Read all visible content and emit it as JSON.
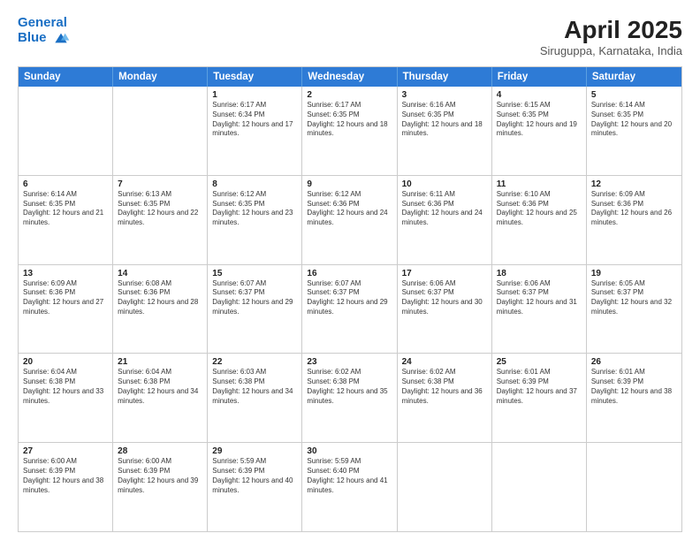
{
  "header": {
    "logo_line1": "General",
    "logo_line2": "Blue",
    "month_year": "April 2025",
    "location": "Siruguppa, Karnataka, India"
  },
  "weekdays": [
    "Sunday",
    "Monday",
    "Tuesday",
    "Wednesday",
    "Thursday",
    "Friday",
    "Saturday"
  ],
  "weeks": [
    [
      {
        "day": "",
        "sunrise": "",
        "sunset": "",
        "daylight": ""
      },
      {
        "day": "",
        "sunrise": "",
        "sunset": "",
        "daylight": ""
      },
      {
        "day": "1",
        "sunrise": "Sunrise: 6:17 AM",
        "sunset": "Sunset: 6:34 PM",
        "daylight": "Daylight: 12 hours and 17 minutes."
      },
      {
        "day": "2",
        "sunrise": "Sunrise: 6:17 AM",
        "sunset": "Sunset: 6:35 PM",
        "daylight": "Daylight: 12 hours and 18 minutes."
      },
      {
        "day": "3",
        "sunrise": "Sunrise: 6:16 AM",
        "sunset": "Sunset: 6:35 PM",
        "daylight": "Daylight: 12 hours and 18 minutes."
      },
      {
        "day": "4",
        "sunrise": "Sunrise: 6:15 AM",
        "sunset": "Sunset: 6:35 PM",
        "daylight": "Daylight: 12 hours and 19 minutes."
      },
      {
        "day": "5",
        "sunrise": "Sunrise: 6:14 AM",
        "sunset": "Sunset: 6:35 PM",
        "daylight": "Daylight: 12 hours and 20 minutes."
      }
    ],
    [
      {
        "day": "6",
        "sunrise": "Sunrise: 6:14 AM",
        "sunset": "Sunset: 6:35 PM",
        "daylight": "Daylight: 12 hours and 21 minutes."
      },
      {
        "day": "7",
        "sunrise": "Sunrise: 6:13 AM",
        "sunset": "Sunset: 6:35 PM",
        "daylight": "Daylight: 12 hours and 22 minutes."
      },
      {
        "day": "8",
        "sunrise": "Sunrise: 6:12 AM",
        "sunset": "Sunset: 6:35 PM",
        "daylight": "Daylight: 12 hours and 23 minutes."
      },
      {
        "day": "9",
        "sunrise": "Sunrise: 6:12 AM",
        "sunset": "Sunset: 6:36 PM",
        "daylight": "Daylight: 12 hours and 24 minutes."
      },
      {
        "day": "10",
        "sunrise": "Sunrise: 6:11 AM",
        "sunset": "Sunset: 6:36 PM",
        "daylight": "Daylight: 12 hours and 24 minutes."
      },
      {
        "day": "11",
        "sunrise": "Sunrise: 6:10 AM",
        "sunset": "Sunset: 6:36 PM",
        "daylight": "Daylight: 12 hours and 25 minutes."
      },
      {
        "day": "12",
        "sunrise": "Sunrise: 6:09 AM",
        "sunset": "Sunset: 6:36 PM",
        "daylight": "Daylight: 12 hours and 26 minutes."
      }
    ],
    [
      {
        "day": "13",
        "sunrise": "Sunrise: 6:09 AM",
        "sunset": "Sunset: 6:36 PM",
        "daylight": "Daylight: 12 hours and 27 minutes."
      },
      {
        "day": "14",
        "sunrise": "Sunrise: 6:08 AM",
        "sunset": "Sunset: 6:36 PM",
        "daylight": "Daylight: 12 hours and 28 minutes."
      },
      {
        "day": "15",
        "sunrise": "Sunrise: 6:07 AM",
        "sunset": "Sunset: 6:37 PM",
        "daylight": "Daylight: 12 hours and 29 minutes."
      },
      {
        "day": "16",
        "sunrise": "Sunrise: 6:07 AM",
        "sunset": "Sunset: 6:37 PM",
        "daylight": "Daylight: 12 hours and 29 minutes."
      },
      {
        "day": "17",
        "sunrise": "Sunrise: 6:06 AM",
        "sunset": "Sunset: 6:37 PM",
        "daylight": "Daylight: 12 hours and 30 minutes."
      },
      {
        "day": "18",
        "sunrise": "Sunrise: 6:06 AM",
        "sunset": "Sunset: 6:37 PM",
        "daylight": "Daylight: 12 hours and 31 minutes."
      },
      {
        "day": "19",
        "sunrise": "Sunrise: 6:05 AM",
        "sunset": "Sunset: 6:37 PM",
        "daylight": "Daylight: 12 hours and 32 minutes."
      }
    ],
    [
      {
        "day": "20",
        "sunrise": "Sunrise: 6:04 AM",
        "sunset": "Sunset: 6:38 PM",
        "daylight": "Daylight: 12 hours and 33 minutes."
      },
      {
        "day": "21",
        "sunrise": "Sunrise: 6:04 AM",
        "sunset": "Sunset: 6:38 PM",
        "daylight": "Daylight: 12 hours and 34 minutes."
      },
      {
        "day": "22",
        "sunrise": "Sunrise: 6:03 AM",
        "sunset": "Sunset: 6:38 PM",
        "daylight": "Daylight: 12 hours and 34 minutes."
      },
      {
        "day": "23",
        "sunrise": "Sunrise: 6:02 AM",
        "sunset": "Sunset: 6:38 PM",
        "daylight": "Daylight: 12 hours and 35 minutes."
      },
      {
        "day": "24",
        "sunrise": "Sunrise: 6:02 AM",
        "sunset": "Sunset: 6:38 PM",
        "daylight": "Daylight: 12 hours and 36 minutes."
      },
      {
        "day": "25",
        "sunrise": "Sunrise: 6:01 AM",
        "sunset": "Sunset: 6:39 PM",
        "daylight": "Daylight: 12 hours and 37 minutes."
      },
      {
        "day": "26",
        "sunrise": "Sunrise: 6:01 AM",
        "sunset": "Sunset: 6:39 PM",
        "daylight": "Daylight: 12 hours and 38 minutes."
      }
    ],
    [
      {
        "day": "27",
        "sunrise": "Sunrise: 6:00 AM",
        "sunset": "Sunset: 6:39 PM",
        "daylight": "Daylight: 12 hours and 38 minutes."
      },
      {
        "day": "28",
        "sunrise": "Sunrise: 6:00 AM",
        "sunset": "Sunset: 6:39 PM",
        "daylight": "Daylight: 12 hours and 39 minutes."
      },
      {
        "day": "29",
        "sunrise": "Sunrise: 5:59 AM",
        "sunset": "Sunset: 6:39 PM",
        "daylight": "Daylight: 12 hours and 40 minutes."
      },
      {
        "day": "30",
        "sunrise": "Sunrise: 5:59 AM",
        "sunset": "Sunset: 6:40 PM",
        "daylight": "Daylight: 12 hours and 41 minutes."
      },
      {
        "day": "",
        "sunrise": "",
        "sunset": "",
        "daylight": ""
      },
      {
        "day": "",
        "sunrise": "",
        "sunset": "",
        "daylight": ""
      },
      {
        "day": "",
        "sunrise": "",
        "sunset": "",
        "daylight": ""
      }
    ]
  ]
}
